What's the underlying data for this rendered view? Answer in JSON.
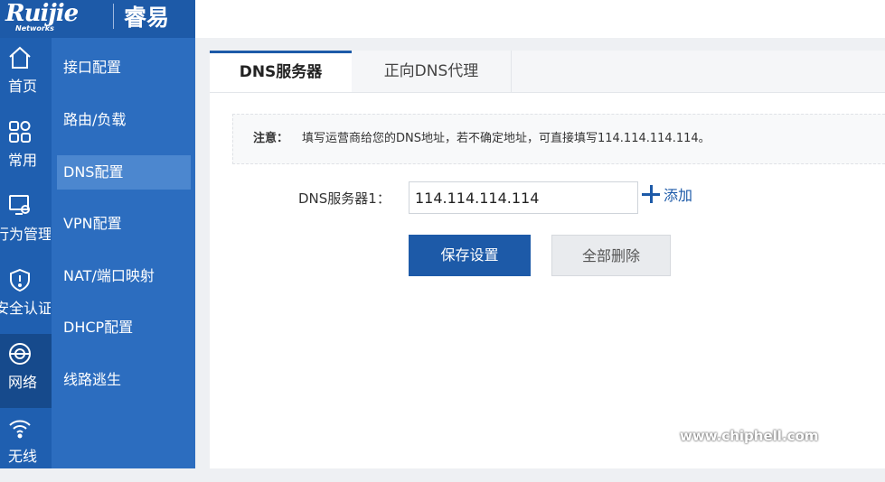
{
  "brand": {
    "logo": "Ruijie",
    "sub": "Networks",
    "product": "睿易"
  },
  "rail": [
    {
      "label": "首页",
      "icon": "home-icon"
    },
    {
      "label": "常用",
      "icon": "grid-icon"
    },
    {
      "label": "行为管理",
      "icon": "monitor-settings-icon"
    },
    {
      "label": "安全认证",
      "icon": "shield-icon"
    },
    {
      "label": "网络",
      "icon": "globe-icon"
    },
    {
      "label": "无线",
      "icon": "wifi-icon"
    }
  ],
  "submenu": [
    {
      "label": "接口配置"
    },
    {
      "label": "路由/负载"
    },
    {
      "label": "DNS配置"
    },
    {
      "label": "VPN配置"
    },
    {
      "label": "NAT/端口映射"
    },
    {
      "label": "DHCP配置"
    },
    {
      "label": "线路逃生"
    }
  ],
  "tabs": [
    {
      "label": "DNS服务器"
    },
    {
      "label": "正向DNS代理"
    }
  ],
  "notice": {
    "key": "注意：",
    "text": "填写运营商给您的DNS地址，若不确定地址，可直接填写114.114.114.114。"
  },
  "form": {
    "dns1_label": "DNS服务器1：",
    "dns1_value": "114.114.114.114",
    "add_label": "添加"
  },
  "buttons": {
    "save": "保存设置",
    "delete_all": "全部删除"
  },
  "watermark": "www.chiphell.com",
  "colors": {
    "primary": "#1d5aa8",
    "rail": "#1f5fb0",
    "submenu": "#2c6dbf"
  }
}
